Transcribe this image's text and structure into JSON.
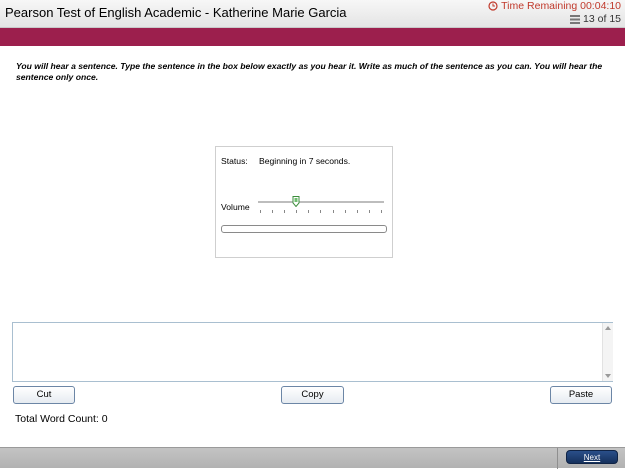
{
  "header": {
    "title": "Pearson Test of English Academic - Katherine Marie Garcia",
    "time_remaining": "Time Remaining 00:04:10",
    "question_counter": "13 of 15",
    "timer_color": "#c0392b",
    "brand_color": "#9c1f4d"
  },
  "icons": {
    "timer": "clock-icon",
    "counter": "list-icon"
  },
  "instruction": "You will hear a sentence. Type the sentence in the box below exactly as you hear it. Write as much of the sentence as you can. You will hear the sentence only once.",
  "audio_player": {
    "status_label": "Status:",
    "status_value": "Beginning in 7 seconds.",
    "volume_label": "Volume",
    "volume_level": 0.3,
    "playback_progress": 0
  },
  "answer": {
    "value": "",
    "placeholder": ""
  },
  "actions": {
    "cut_label": "Cut",
    "copy_label": "Copy",
    "paste_label": "Paste"
  },
  "word_count_text": "Total Word Count: 0",
  "footer": {
    "next_label": "Next"
  }
}
